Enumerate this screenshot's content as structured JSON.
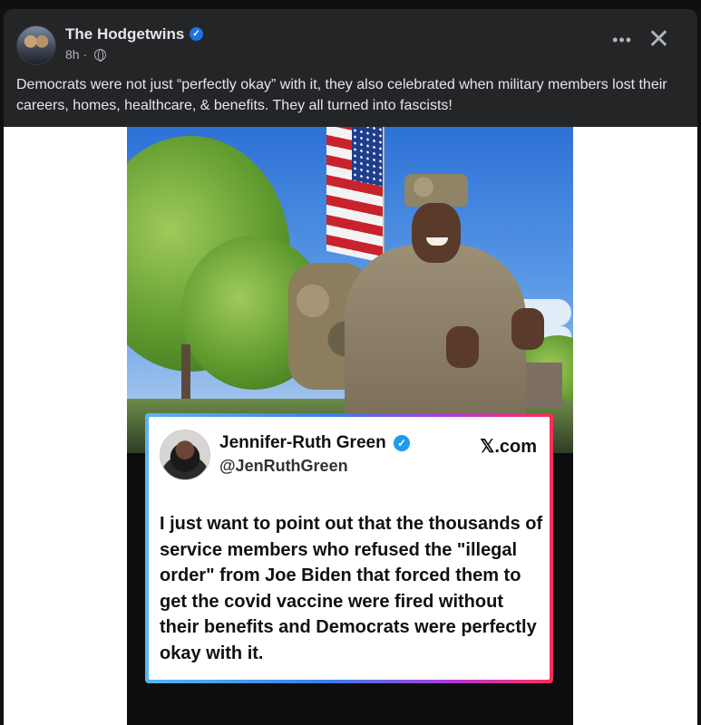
{
  "post": {
    "author": "The Hodgetwins",
    "timestamp": "8h ·",
    "text": "Democrats were not just “perfectly okay” with it, they also celebrated when  military members lost their careers, homes, healthcare, & benefits. They all turned into fascists!",
    "actions": {
      "more": "•••",
      "close": "✕"
    }
  },
  "tweet": {
    "name": "Jennifer-Ruth Green",
    "handle": "@JenRuthGreen",
    "source": "𝕏.com",
    "text": "I just want to point out that the thousands of service members who refused the \"illegal order\" from Joe Biden that forced them to get the covid vaccine were fired without their benefits and Democrats were perfectly okay with it."
  },
  "icons": {
    "verified": "✓"
  },
  "colors": {
    "background": "#242526",
    "text": "#e4e6eb",
    "verified": "#1b74e4",
    "tweet_verified": "#1d9bf0"
  }
}
